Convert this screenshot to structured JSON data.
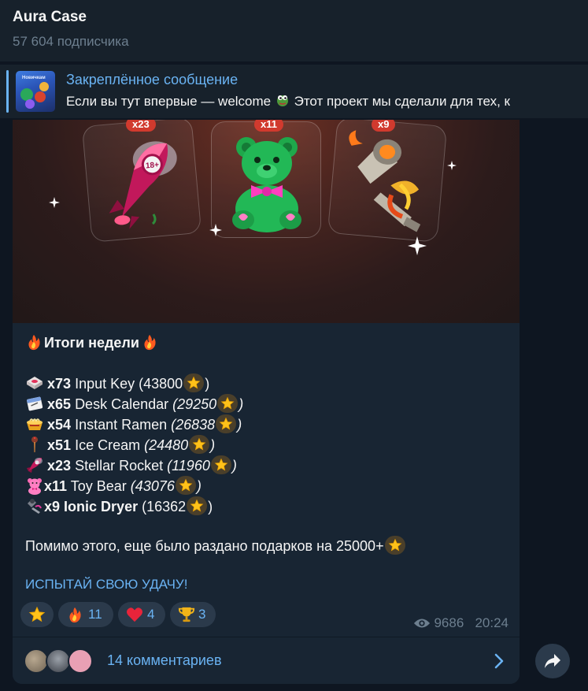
{
  "header": {
    "title": "Aura Case",
    "subscribers": "57 604 подписчика"
  },
  "pinned": {
    "title": "Закреплённое сообщение",
    "text_before": "Если вы тут впервые — welcome",
    "text_after": "Этот проект мы сделали для тех, к",
    "thumb_label": "Новичкам",
    "frog_icon": "pepe-frog-emoji"
  },
  "media": {
    "cards": [
      {
        "badge": "x23",
        "icon": "stellar-rocket-icon"
      },
      {
        "badge": "x11",
        "icon": "toy-bear-icon"
      },
      {
        "badge": "x9",
        "icon": "ionic-dryer-icon"
      }
    ],
    "rocket_label": "18+"
  },
  "post": {
    "heading": "Итоги недели",
    "items": [
      {
        "count": "x73",
        "name": "Input Key",
        "value": "(43800",
        "close": ")",
        "icon": "input-key-icon"
      },
      {
        "count": "x65",
        "name": "Desk Calendar",
        "value": "(29250",
        "close": ")",
        "icon": "desk-calendar-icon"
      },
      {
        "count": "x54",
        "name": "Instant Ramen",
        "value": "(26838",
        "close": ")",
        "icon": "instant-ramen-icon"
      },
      {
        "count": "x51",
        "name": "Ice Cream",
        "value": "(24480",
        "close": ")",
        "icon": "ice-cream-icon"
      },
      {
        "count": "x23",
        "name": "Stellar Rocket",
        "value": "(11960",
        "close": ")",
        "icon": "stellar-rocket-icon"
      },
      {
        "count": "x11",
        "name": "Toy Bear",
        "value": "(43076",
        "close": ")",
        "icon": "toy-bear-icon"
      },
      {
        "count": "x9",
        "name": "Ionic Dryer",
        "value": "(16362",
        "close": ")",
        "icon": "ionic-dryer-icon"
      }
    ],
    "extra": "Помимо этого, еще было раздано подарков на 25000+",
    "cta": "ИСПЫТАЙ СВОЮ УДАЧУ!"
  },
  "reactions": [
    {
      "icon": "star-icon",
      "count": ""
    },
    {
      "icon": "fire-icon",
      "count": "11"
    },
    {
      "icon": "heart-icon",
      "count": "4"
    },
    {
      "icon": "trophy-icon",
      "count": "3"
    }
  ],
  "meta": {
    "views": "9686",
    "time": "20:24"
  },
  "comments": {
    "label": "14 комментариев"
  },
  "colors": {
    "background": "#0e1621",
    "bubble": "#182533",
    "accent": "#6ab3f3",
    "muted": "#6d7f8f"
  }
}
